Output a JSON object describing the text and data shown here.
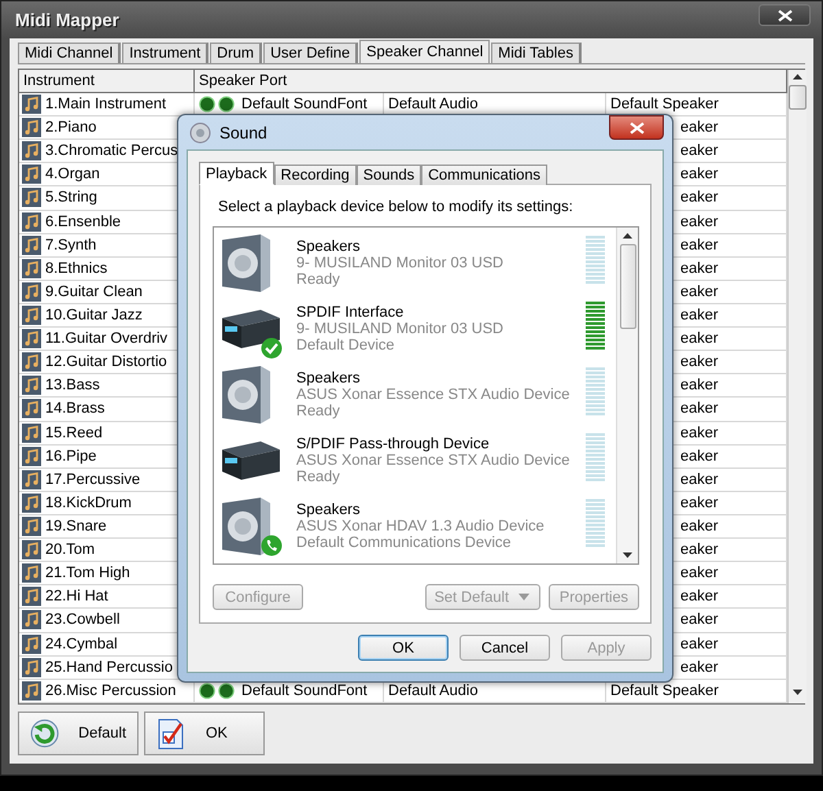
{
  "window": {
    "title": "Midi Mapper"
  },
  "tabs": [
    {
      "label": "Midi Channel",
      "selected": false
    },
    {
      "label": "Instrument",
      "selected": false
    },
    {
      "label": "Drum",
      "selected": false
    },
    {
      "label": "User Define",
      "selected": false
    },
    {
      "label": "Speaker Channel",
      "selected": true
    },
    {
      "label": "Midi Tables",
      "selected": false
    }
  ],
  "table": {
    "columns": [
      "Instrument",
      "Speaker Port"
    ],
    "rows": [
      {
        "kind": "full",
        "name": "1.Main Instrument",
        "soundfont": "Default SoundFont",
        "audio": "Default Audio",
        "speaker": "Default Speaker"
      },
      {
        "kind": "covered",
        "name": "2.Piano",
        "speaker": "eaker"
      },
      {
        "kind": "covered",
        "name": "3.Chromatic Percus",
        "speaker": "eaker"
      },
      {
        "kind": "covered",
        "name": "4.Organ",
        "speaker": "eaker"
      },
      {
        "kind": "covered",
        "name": "5.String",
        "speaker": "eaker"
      },
      {
        "kind": "covered",
        "name": "6.Ensenble",
        "speaker": "eaker"
      },
      {
        "kind": "covered",
        "name": "7.Synth",
        "speaker": "eaker"
      },
      {
        "kind": "covered",
        "name": "8.Ethnics",
        "speaker": "eaker"
      },
      {
        "kind": "covered",
        "name": "9.Guitar Clean",
        "speaker": "eaker"
      },
      {
        "kind": "covered",
        "name": "10.Guitar Jazz",
        "speaker": "eaker"
      },
      {
        "kind": "covered",
        "name": "11.Guitar Overdriv",
        "speaker": "eaker"
      },
      {
        "kind": "covered",
        "name": "12.Guitar Distortio",
        "speaker": "eaker"
      },
      {
        "kind": "covered",
        "name": "13.Bass",
        "speaker": "eaker"
      },
      {
        "kind": "covered",
        "name": "14.Brass",
        "speaker": "eaker"
      },
      {
        "kind": "covered",
        "name": "15.Reed",
        "speaker": "eaker"
      },
      {
        "kind": "covered",
        "name": "16.Pipe",
        "speaker": "eaker"
      },
      {
        "kind": "covered",
        "name": "17.Percussive",
        "speaker": "eaker"
      },
      {
        "kind": "covered",
        "name": "18.KickDrum",
        "speaker": "eaker"
      },
      {
        "kind": "covered",
        "name": "19.Snare",
        "speaker": "eaker"
      },
      {
        "kind": "covered",
        "name": "20.Tom",
        "speaker": "eaker"
      },
      {
        "kind": "covered",
        "name": "21.Tom High",
        "speaker": "eaker"
      },
      {
        "kind": "covered",
        "name": "22.Hi Hat",
        "speaker": "eaker"
      },
      {
        "kind": "covered",
        "name": "23.Cowbell",
        "speaker": "eaker"
      },
      {
        "kind": "covered",
        "name": "24.Cymbal",
        "speaker": "eaker"
      },
      {
        "kind": "covered",
        "name": "25.Hand Percussio",
        "speaker": "eaker"
      },
      {
        "kind": "full",
        "name": "26.Misc Percussion",
        "soundfont": "Default SoundFont",
        "audio": "Default Audio",
        "speaker": "Default Speaker"
      }
    ]
  },
  "buttons": [
    {
      "kind": "default",
      "label": "Default"
    },
    {
      "kind": "ok",
      "label": "OK"
    }
  ],
  "dialog": {
    "title": "Sound",
    "tabs": [
      {
        "label": "Playback",
        "selected": true
      },
      {
        "label": "Recording",
        "selected": false
      },
      {
        "label": "Sounds",
        "selected": false
      },
      {
        "label": "Communications",
        "selected": false
      }
    ],
    "instruction": "Select a playback device below to modify its settings:",
    "devices": [
      {
        "kind": "speaker",
        "default_device": false,
        "default_comms": false,
        "name": "Speakers",
        "description": "9- MUSILAND Monitor 03 USD",
        "status": "Ready",
        "level": 0
      },
      {
        "kind": "receiver",
        "default_device": true,
        "default_comms": false,
        "name": "SPDIF Interface",
        "description": "9- MUSILAND Monitor 03 USD",
        "status": "Default Device",
        "level": 1
      },
      {
        "kind": "speaker",
        "default_device": false,
        "default_comms": false,
        "name": "Speakers",
        "description": "ASUS Xonar Essence STX Audio Device",
        "status": "Ready",
        "level": 0
      },
      {
        "kind": "receiver",
        "default_device": false,
        "default_comms": false,
        "name": "S/PDIF Pass-through Device",
        "description": "ASUS Xonar Essence STX Audio Device",
        "status": "Ready",
        "level": 0
      },
      {
        "kind": "speaker",
        "default_device": false,
        "default_comms": true,
        "name": "Speakers",
        "description": "ASUS Xonar HDAV 1.3 Audio Device",
        "status": "Default Communications Device",
        "level": 0
      }
    ],
    "list_buttons": [
      {
        "kind": "plain",
        "label": "Configure",
        "disabled": true
      },
      {
        "kind": "split",
        "label": "Set Default",
        "disabled": true
      },
      {
        "kind": "plain",
        "label": "Properties",
        "disabled": true
      }
    ],
    "buttons": [
      {
        "label": "OK",
        "disabled": false,
        "focused": true
      },
      {
        "label": "Cancel",
        "disabled": false,
        "focused": false
      },
      {
        "label": "Apply",
        "disabled": true,
        "focused": false
      }
    ]
  }
}
